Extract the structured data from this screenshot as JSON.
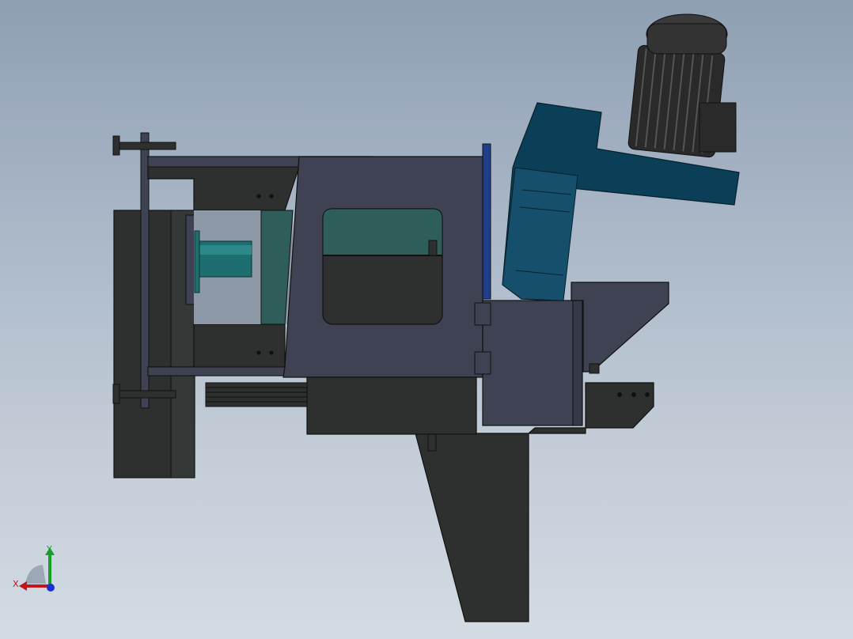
{
  "viewport": {
    "background_top": "#8f9fb3",
    "background_bottom": "#d3dbe3"
  },
  "model": {
    "colors": {
      "dark_body": "#2d302f",
      "slate_body": "#3f4252",
      "teal_panel": "#2f5d5a",
      "teal_shaft": "#1d6e6e",
      "blue_bracket": "#0b3f57",
      "motor_dark": "#2a2a2a",
      "blue_edge": "#1f3f8a"
    },
    "components": [
      "base-leg",
      "vise-column",
      "vise-plate",
      "handwheel-screws",
      "top-arm",
      "bottom-arm",
      "housing",
      "front-window",
      "side-window",
      "spindle-shaft",
      "lower-block",
      "gear-box",
      "motor-bracket",
      "motor",
      "chute"
    ]
  },
  "triad": {
    "x_label": "X",
    "y_label": "Y",
    "x_color": "#c0161c",
    "y_color": "#16a02a",
    "z_color": "#1a2fd6"
  }
}
